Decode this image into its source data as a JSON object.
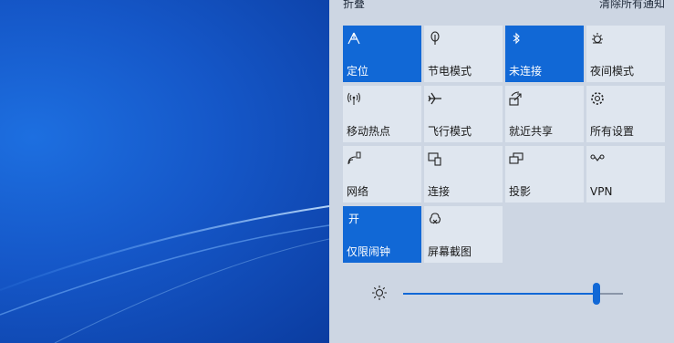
{
  "action_center": {
    "collapse_label": "折叠",
    "clear_label": "清除所有通知",
    "tiles": [
      {
        "label": "定位",
        "icon": "location-icon",
        "active": true
      },
      {
        "label": "节电模式",
        "icon": "battery-saver-icon",
        "active": false
      },
      {
        "label": "未连接",
        "icon": "bluetooth-icon",
        "active": true
      },
      {
        "label": "夜间模式",
        "icon": "night-light-icon",
        "active": false
      },
      {
        "label": "移动热点",
        "icon": "hotspot-icon",
        "active": false
      },
      {
        "label": "飞行模式",
        "icon": "airplane-icon",
        "active": false
      },
      {
        "label": "就近共享",
        "icon": "nearby-share-icon",
        "active": false
      },
      {
        "label": "所有设置",
        "icon": "gear-icon",
        "active": false
      },
      {
        "label": "网络",
        "icon": "network-icon",
        "active": false
      },
      {
        "label": "连接",
        "icon": "connect-icon",
        "active": false
      },
      {
        "label": "投影",
        "icon": "project-icon",
        "active": false
      },
      {
        "label": "VPN",
        "icon": "vpn-icon",
        "active": false
      },
      {
        "label": "仅限闹钟",
        "icon_text": "开",
        "icon": "focus-assist-icon",
        "active": true
      },
      {
        "label": "屏幕截图",
        "icon": "screen-snip-icon",
        "active": false
      }
    ],
    "brightness": {
      "icon": "brightness-icon",
      "value_fraction": 0.88
    }
  },
  "colors": {
    "accent": "#1168d6",
    "panel": "#cdd6e3",
    "tile": "#dfe6ef"
  }
}
